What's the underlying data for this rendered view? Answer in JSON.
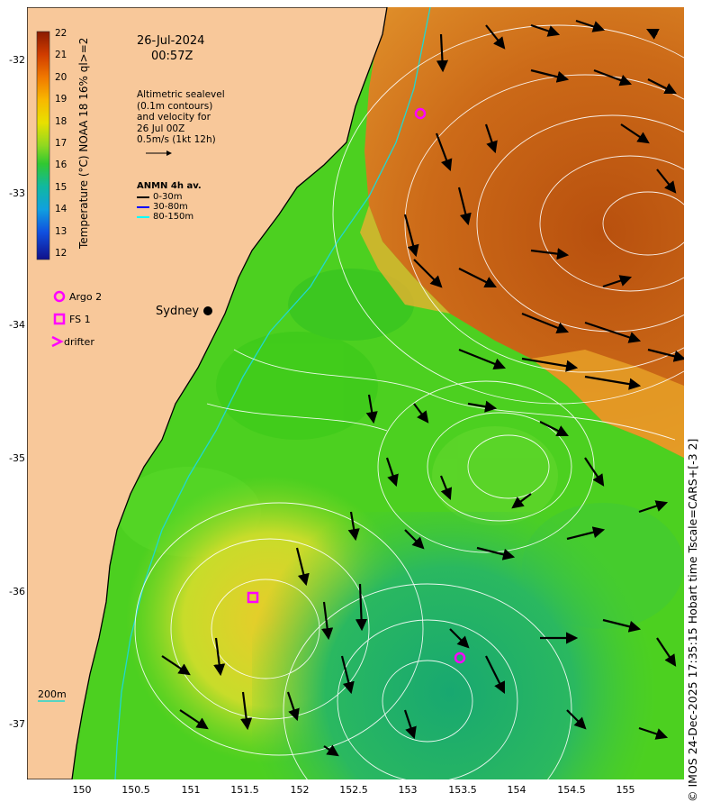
{
  "map": {
    "date": "26-Jul-2024",
    "time": "00:57Z",
    "altimetry_note": [
      "Altimetric sealevel",
      "(0.1m contours)",
      "and velocity for",
      "26 Jul 00Z",
      "0.5m/s (1kt 12h)"
    ],
    "anmn_title": "ANMN 4h av.",
    "anmn_legend": [
      {
        "label": "0-30m",
        "color": "#000000"
      },
      {
        "label": "30-80m",
        "color": "#0000ff"
      },
      {
        "label": "80-150m",
        "color": "#00ffff"
      }
    ],
    "markers_legend": [
      {
        "label": "Argo 2",
        "symbol": "circle"
      },
      {
        "label": "FS 1",
        "symbol": "square"
      },
      {
        "label": "drifter",
        "symbol": "chevron"
      }
    ],
    "city": "Sydney",
    "scale_label": "200m",
    "marker_color": "#ff00ff",
    "colorbar": {
      "title": "Temperature (°C) NOAA 18 16% ql>=2",
      "ticks": [
        "22",
        "21",
        "20",
        "19",
        "18",
        "17",
        "16",
        "15",
        "14",
        "13",
        "12"
      ],
      "range": [
        11.5,
        22
      ]
    },
    "x_ticks": [
      "150",
      "150.5",
      "151",
      "151.5",
      "152",
      "152.5",
      "153",
      "153.5",
      "154",
      "154.5",
      "155"
    ],
    "y_ticks": [
      "-32",
      "-33",
      "-34",
      "-35",
      "-36",
      "-37"
    ],
    "lon_range": [
      149.5,
      155.5
    ],
    "lat_range": [
      -37.4,
      -31.6
    ],
    "credit": "© IMOS 24-Dec-2025 17:35:15 Hobart time Tscale=CARS+[-3 2]",
    "colors": {
      "land": "#f8c89a",
      "warm_water": "#c8641a",
      "mid_water": "#4ad41e",
      "cool_water": "#20b070",
      "coast": "#000000",
      "isobath": "#20c8c0"
    }
  }
}
